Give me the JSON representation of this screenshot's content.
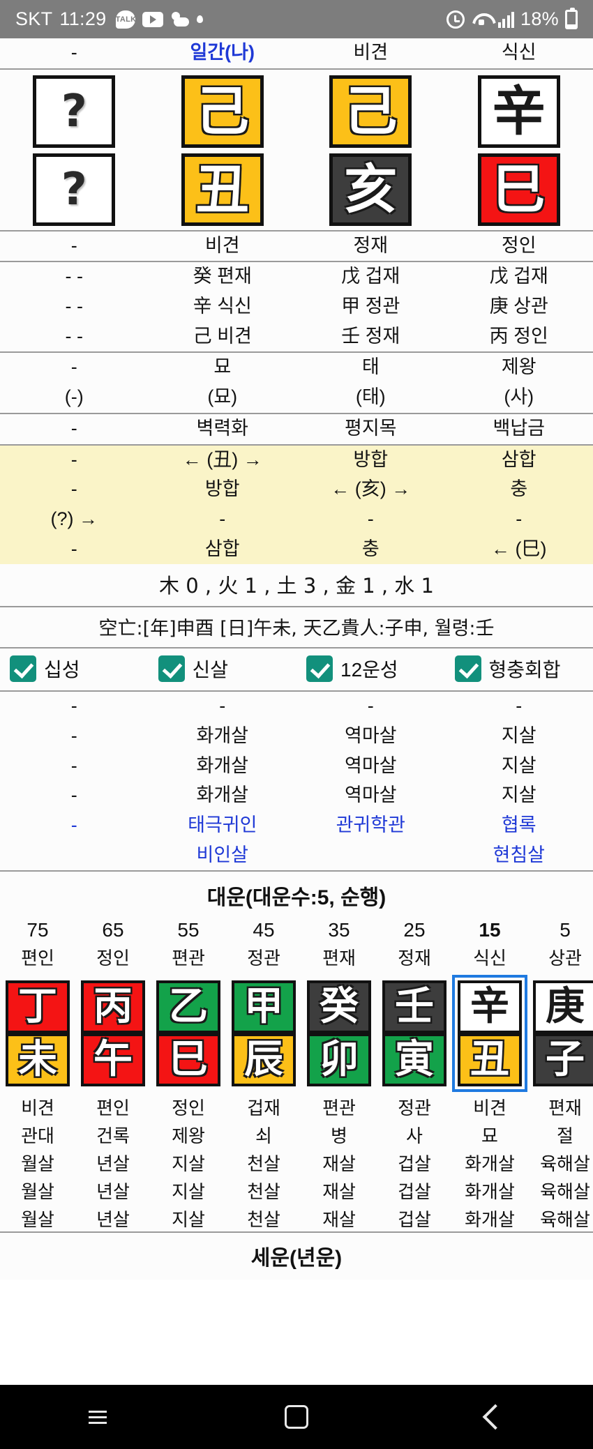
{
  "statusbar": {
    "carrier": "SKT",
    "time": "11:29",
    "battery_pct": "18%",
    "icons": [
      "kakaotalk-icon",
      "youtube-icon",
      "weather-icon",
      "dot-icon",
      "alarm-icon",
      "wifi-icon",
      "signal-icon",
      "battery-icon"
    ]
  },
  "pillars": {
    "header": [
      "-",
      "일간(나)",
      "비견",
      "식신"
    ],
    "stems": [
      {
        "char": "?",
        "color": "white"
      },
      {
        "char": "己",
        "color": "yellow"
      },
      {
        "char": "己",
        "color": "yellow"
      },
      {
        "char": "辛",
        "color": "white"
      }
    ],
    "branches": [
      {
        "char": "?",
        "color": "white"
      },
      {
        "char": "丑",
        "color": "yellow"
      },
      {
        "char": "亥",
        "color": "dark"
      },
      {
        "char": "巳",
        "color": "red"
      }
    ],
    "branch_sipseong": [
      "-",
      "비견",
      "정재",
      "정인"
    ],
    "hidden_stems": [
      [
        "- -",
        "癸 편재",
        "戊 겁재",
        "戊 겁재"
      ],
      [
        "- -",
        "辛 식신",
        "甲 정관",
        "庚 상관"
      ],
      [
        "- -",
        "己 비견",
        "壬 정재",
        "丙 정인"
      ]
    ],
    "unseong": [
      "-",
      "묘",
      "태",
      "제왕"
    ],
    "unseong_alt": [
      "(-)",
      "(묘)",
      "(태)",
      "(사)"
    ],
    "napeum": [
      "-",
      "벽력화",
      "평지목",
      "백납금"
    ]
  },
  "hapchung": {
    "rows": [
      [
        "-",
        "← (丑) →",
        "방합",
        "삼합"
      ],
      [
        "-",
        "방합",
        "← (亥) →",
        "충"
      ],
      [
        "(?) →",
        "-",
        "-",
        "-"
      ],
      [
        "-",
        "삼합",
        "충",
        "← (巳)"
      ]
    ]
  },
  "ohaeng_line": "木 0 , 火 1 , 土 3 , 金 1 , 水 1",
  "info_line": "空亡:[年]申酉 [日]午未, 天乙貴人:子申, 월령:壬",
  "toggles": [
    {
      "label": "십성",
      "checked": true
    },
    {
      "label": "신살",
      "checked": true
    },
    {
      "label": "12운성",
      "checked": true
    },
    {
      "label": "형충회합",
      "checked": true
    }
  ],
  "sinsal": {
    "rows": [
      [
        "-",
        "-",
        "-",
        "-"
      ],
      [
        "-",
        "화개살",
        "역마살",
        "지살"
      ],
      [
        "-",
        "화개살",
        "역마살",
        "지살"
      ],
      [
        "-",
        "화개살",
        "역마살",
        "지살"
      ]
    ],
    "special_rows": [
      [
        "-",
        "태극귀인",
        "관귀학관",
        "협록"
      ],
      [
        "",
        "비인살",
        "",
        "현침살"
      ]
    ]
  },
  "daeun": {
    "title": "대운(대운수:5, 순행)",
    "columns": [
      {
        "age": "75",
        "sipseong": "편인",
        "stem": "丁",
        "stem_color": "red",
        "branch": "未",
        "branch_color": "yellow",
        "sub1": "비견",
        "sub2": "관대",
        "sub3": "월살",
        "sub4": "월살",
        "sub5": "월살",
        "selected": false
      },
      {
        "age": "65",
        "sipseong": "정인",
        "stem": "丙",
        "stem_color": "red",
        "branch": "午",
        "branch_color": "red",
        "sub1": "편인",
        "sub2": "건록",
        "sub3": "년살",
        "sub4": "년살",
        "sub5": "년살",
        "selected": false
      },
      {
        "age": "55",
        "sipseong": "편관",
        "stem": "乙",
        "stem_color": "green",
        "branch": "巳",
        "branch_color": "red",
        "sub1": "정인",
        "sub2": "제왕",
        "sub3": "지살",
        "sub4": "지살",
        "sub5": "지살",
        "selected": false
      },
      {
        "age": "45",
        "sipseong": "정관",
        "stem": "甲",
        "stem_color": "green",
        "branch": "辰",
        "branch_color": "yellow",
        "sub1": "겁재",
        "sub2": "쇠",
        "sub3": "천살",
        "sub4": "천살",
        "sub5": "천살",
        "selected": false
      },
      {
        "age": "35",
        "sipseong": "편재",
        "stem": "癸",
        "stem_color": "dark",
        "branch": "卯",
        "branch_color": "green",
        "sub1": "편관",
        "sub2": "병",
        "sub3": "재살",
        "sub4": "재살",
        "sub5": "재살",
        "selected": false
      },
      {
        "age": "25",
        "sipseong": "정재",
        "stem": "壬",
        "stem_color": "dark",
        "branch": "寅",
        "branch_color": "green",
        "sub1": "정관",
        "sub2": "사",
        "sub3": "겁살",
        "sub4": "겁살",
        "sub5": "겁살",
        "selected": false
      },
      {
        "age": "15",
        "sipseong": "식신",
        "stem": "辛",
        "stem_color": "white",
        "branch": "丑",
        "branch_color": "yellow",
        "sub1": "비견",
        "sub2": "묘",
        "sub3": "화개살",
        "sub4": "화개살",
        "sub5": "화개살",
        "selected": true
      },
      {
        "age": "5",
        "sipseong": "상관",
        "stem": "庚",
        "stem_color": "white",
        "branch": "子",
        "branch_color": "dark",
        "sub1": "편재",
        "sub2": "절",
        "sub3": "육해살",
        "sub4": "육해살",
        "sub5": "육해살",
        "selected": false
      }
    ]
  },
  "seun": {
    "title": "세운(년운)"
  },
  "navbar": {
    "recents": "recents-icon",
    "home": "home-icon",
    "back": "back-icon"
  },
  "colors": {
    "yellow": "#fcc018",
    "red": "#f41414",
    "dark": "#3d3d3d",
    "green": "#13a24a",
    "accent_blue": "#1f39d6",
    "select_blue": "#1f7ae0",
    "check_green": "#12907c",
    "hap_bg": "#faf4c8"
  }
}
